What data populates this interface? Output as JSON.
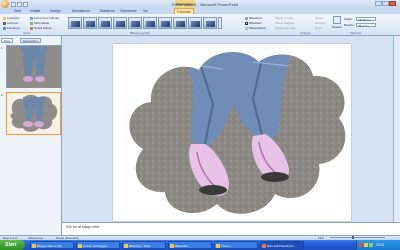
{
  "window": {
    "title": "Presentation1 - Microsoft PowerPoint",
    "context_tab_title": "Billedværktøjer"
  },
  "tabs": [
    {
      "label": "Start"
    },
    {
      "label": "Indsæt"
    },
    {
      "label": "Design"
    },
    {
      "label": "Animationer"
    },
    {
      "label": "Diasshow"
    },
    {
      "label": "Gennemse"
    },
    {
      "label": "Vis"
    },
    {
      "label": "Formatér",
      "active": true
    }
  ],
  "ribbon": {
    "adjust": {
      "items": [
        "Lysstyrke",
        "Kontrast",
        "Farvelæg"
      ],
      "items_right": [
        "Komprimer billeder",
        "Skift billede",
        "Nulstil billede"
      ],
      "label": "Juster"
    },
    "styles": {
      "label": "Billedtypografier"
    },
    "picture_options": {
      "items": [
        "Billedform",
        "Billedkant",
        "Billedeffekter"
      ]
    },
    "arrange": {
      "items": [
        "Placer forrest",
        "Placer bagerst",
        "Markeringsrude"
      ],
      "items_right": [
        "Juster",
        "Grupper",
        "Roter"
      ],
      "label": "Arranger"
    },
    "size": {
      "crop_label": "Beskær",
      "height_label": "Højde:",
      "height_value": "18,06 cm",
      "width_label": "Bredde:",
      "width_value": "25,4 cm",
      "label": "Størrelse"
    }
  },
  "left_pane": {
    "tabs": [
      "Dias",
      "Disposition"
    ],
    "slides": [
      "1",
      "2"
    ]
  },
  "notes_placeholder": "Klik for at tilføje noter",
  "status": {
    "slide": "Dias 2 af 2",
    "theme": "Office-tema",
    "language": "Dansk (Danmark)",
    "zoom": "63%"
  },
  "taskbar": {
    "start": "Start",
    "tasks": [
      {
        "label": "Blogger: Ikke et dyb..."
      },
      {
        "label": "Innbok: fotobloggin..."
      },
      {
        "label": "Bilde1.jpg - Paint"
      },
      {
        "label": "Bildeskifte..."
      },
      {
        "label": "Photo 1"
      },
      {
        "label": "Microsoft PowerPoint...",
        "active": true
      }
    ],
    "clock": "20:26"
  },
  "colors": {
    "ribbon_blue": "#c4d8f0",
    "context_tab": "#f3d37a",
    "taskbar_blue": "#245edb",
    "selection_orange": "#f29d30"
  }
}
